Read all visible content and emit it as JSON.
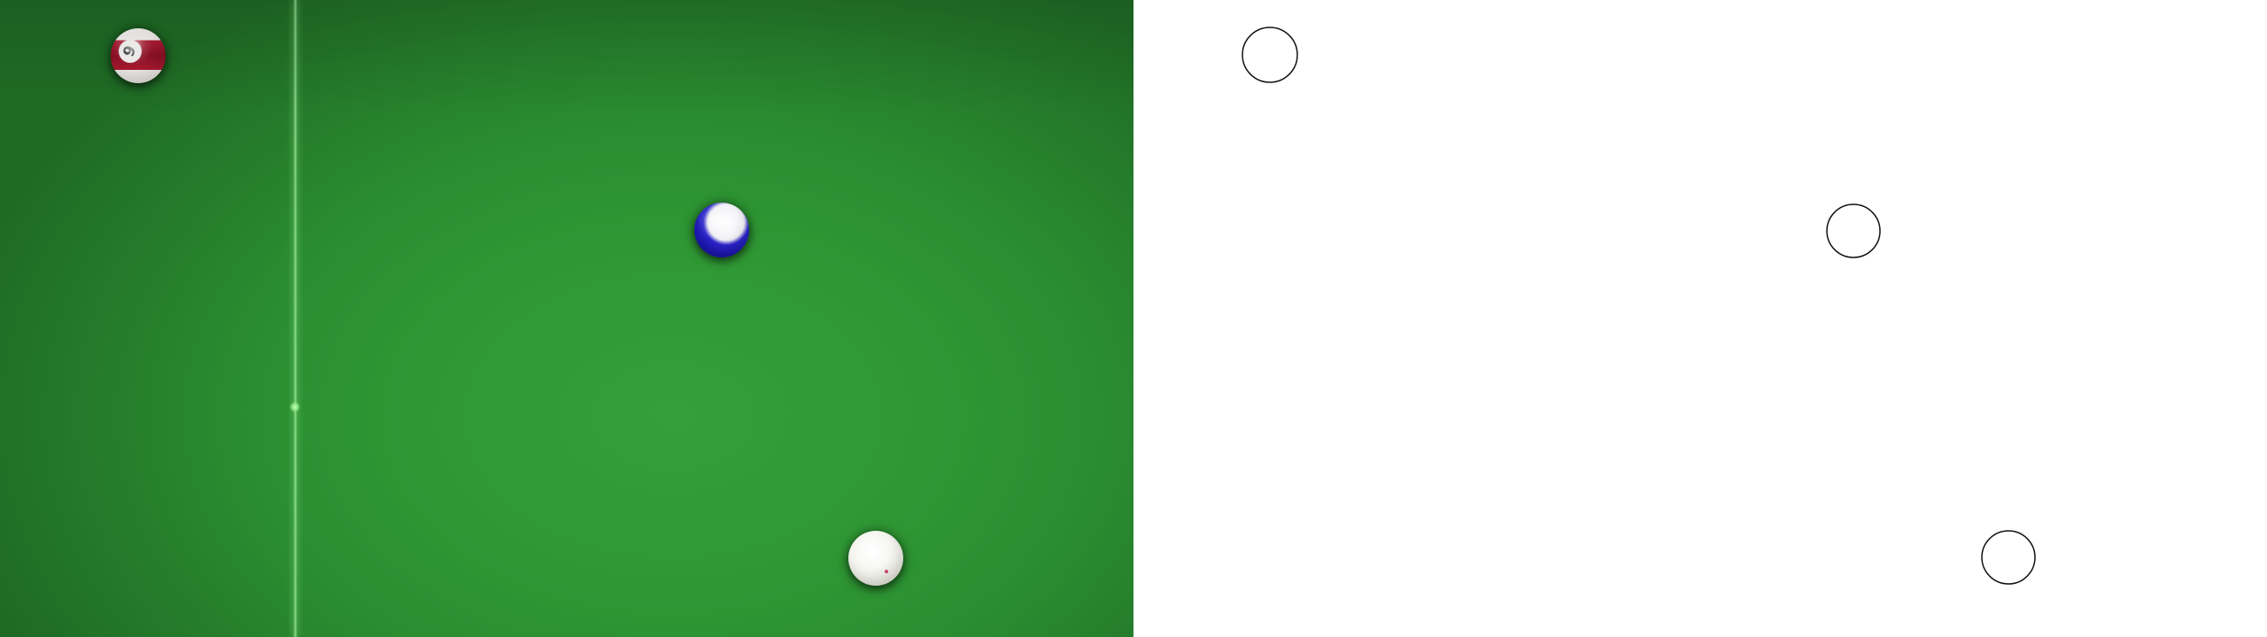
{
  "table": {
    "felt_color": "#2f9834",
    "string_line_color": "#aaf5a5"
  },
  "balls": [
    {
      "id": "red-stripe",
      "number": "9",
      "style": "stripe",
      "color": "#b21a33"
    },
    {
      "id": "blue-stripe",
      "number": "",
      "style": "stripe",
      "color": "#1b15a8"
    },
    {
      "id": "cue",
      "number": "",
      "style": "solid",
      "color": "#f4f4ee"
    }
  ],
  "outline": {
    "background": "#ffffff",
    "stroke_color": "#111111"
  }
}
